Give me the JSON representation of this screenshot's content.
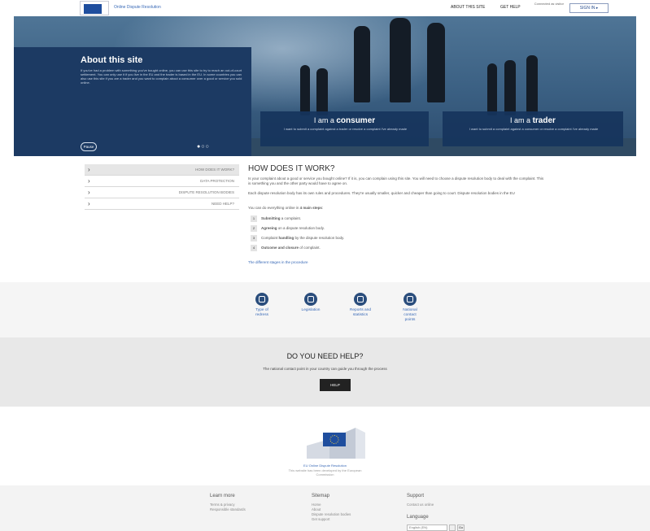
{
  "header": {
    "site_title": "Online Dispute Resolution",
    "nav_about": "ABOUT THIS SITE",
    "nav_help": "GET HELP",
    "nav_connected": "Connected as visitor",
    "signin_label": "SIGN IN ▸"
  },
  "hero": {
    "about_title": "About this site",
    "about_text": "If you've had a problem with something you've bought online, you can use this site to try to reach an out-of-court settlement. You can only use it if you live in the EU and the trader is based in the EU. In some countries you can also use this site if you are a trader and you want to complain about a consumer over a good or service you sold online.",
    "pause_label": "Pause",
    "dots": "●○○",
    "consumer_prefix": "I am a",
    "consumer_word": "consumer",
    "consumer_desc": "I want to submit a complaint against a trader or resolve a complaint I've already made",
    "trader_prefix": "I am a",
    "trader_word": "trader",
    "trader_desc": "I want to submit a complaint against a consumer or resolve a complaint I've already made"
  },
  "sidebar": {
    "items": [
      {
        "label": "HOW DOES IT WORK?"
      },
      {
        "label": "DATA PROTECTION"
      },
      {
        "label": "DISPUTE RESOLUTION BODIES"
      },
      {
        "label": "NEED HELP?"
      }
    ]
  },
  "main": {
    "title": "HOW DOES IT WORK?",
    "p1": "Is your complaint about a good or service you bought online? If it is, you can complain using this site. You will need to choose a dispute resolution body to deal with the complaint. This is something you and the other party would have to agree on.",
    "p2": "Each dispute resolution body has its own rules and procedures. They're usually smaller, quicker and cheaper than going to court. Dispute resolution bodies in the EU",
    "p3_prefix": "You can do everything online in ",
    "p3_bold": "4 main steps",
    "p3_suffix": ":",
    "steps": [
      {
        "num": "1",
        "bold": "Submitting",
        "rest": " a complaint."
      },
      {
        "num": "2",
        "bold": "Agreeing",
        "rest": " on a dispute resolution body."
      },
      {
        "num": "3",
        "pre": "Complaint ",
        "bold": "handling",
        "rest": " by the dispute resolution body."
      },
      {
        "num": "4",
        "bold": "Outcome and closure",
        "rest": " of complaint."
      }
    ],
    "proc_link": "The different stages in the procedure"
  },
  "icons": [
    {
      "name": "types-of-redress-icon",
      "label_1": "Type of",
      "label_2": "redress",
      "label_3": ""
    },
    {
      "name": "legislation-icon",
      "label_1": "Legislation",
      "label_2": "",
      "label_3": ""
    },
    {
      "name": "reports-statistics-icon",
      "label_1": "Reports and",
      "label_2": "statistics",
      "label_3": ""
    },
    {
      "name": "national-contact-points-icon",
      "label_1": "National",
      "label_2": "contact",
      "label_3": "points"
    }
  ],
  "help": {
    "title": "DO YOU NEED HELP?",
    "text": "The national contact point in your country can guide you through the process",
    "button_label": "HELP"
  },
  "footer": {
    "name": "EU Online Dispute Resolution",
    "note_1": "This website has been developed by the European",
    "note_2": "Commission",
    "col1_title": "Learn more",
    "col1_links": [
      "Terms & privacy",
      "Responsible standards"
    ],
    "col2_title": "Sitemap",
    "col2_links": [
      "Home",
      "About",
      "Dispute resolution bodies",
      "Get support"
    ],
    "col3_title": "Support",
    "col3_links": [
      "Contact us online"
    ],
    "lang_title": "Language",
    "lang_value": "English (EN)",
    "lang_go": "Go"
  },
  "colors": {
    "hero_dark": "#1c3a63",
    "link_blue": "#3a6ab7",
    "icon_blue": "#2a4d7c"
  }
}
